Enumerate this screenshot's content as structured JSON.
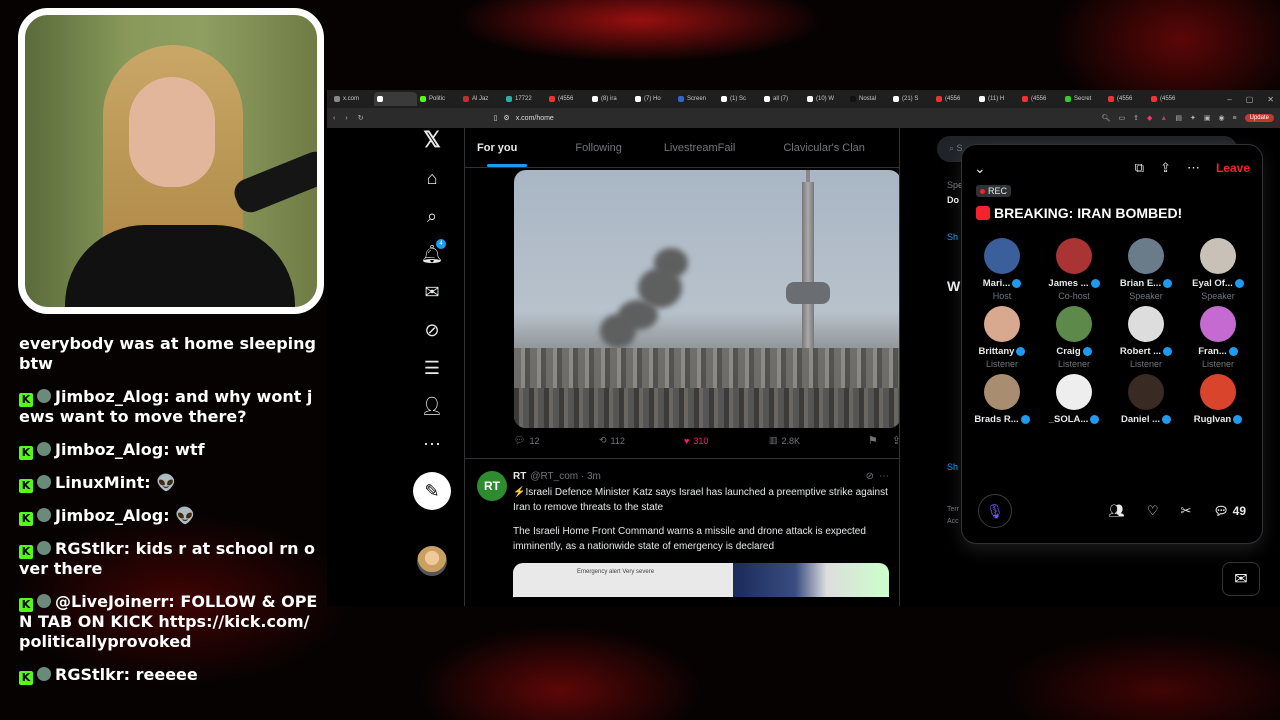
{
  "chat": {
    "messages": [
      {
        "user": "",
        "text": "everybody was at home sleeping btw"
      },
      {
        "user": "Jimboz_Alog",
        "text": ": and why wont jews want to move there?"
      },
      {
        "user": "Jimboz_Alog",
        "text": ": wtf"
      },
      {
        "user": "LinuxMint",
        "text": ": 👽"
      },
      {
        "user": "Jimboz_Alog",
        "text": ": 👽"
      },
      {
        "user": "RGStlkr",
        "text": ": kids r at school rn over there"
      },
      {
        "user": "@LiveJoinerr",
        "text": ": FOLLOW & OPEN TAB ON KICK https://kick.com/politicallyprovoked"
      },
      {
        "user": "RGStlkr",
        "text": ": reeeee"
      }
    ]
  },
  "browser": {
    "tabs": [
      {
        "label": "x.com",
        "color": "#888"
      },
      {
        "label": "",
        "color": "#fff",
        "active": true
      },
      {
        "label": "Politic",
        "color": "#53fc18"
      },
      {
        "label": "Al Jaz",
        "color": "#c03030"
      },
      {
        "label": "17722",
        "color": "#3aa"
      },
      {
        "label": "(4556",
        "color": "#e33"
      },
      {
        "label": "(8) ira",
        "color": "#fff"
      },
      {
        "label": "(7) Ho",
        "color": "#fff"
      },
      {
        "label": "Screen",
        "color": "#36c"
      },
      {
        "label": "(1) Sc",
        "color": "#fff"
      },
      {
        "label": "all (7)",
        "color": "#fff"
      },
      {
        "label": "(10) W",
        "color": "#fff"
      },
      {
        "label": "Nostal",
        "color": "#111"
      },
      {
        "label": "(21) S",
        "color": "#fff"
      },
      {
        "label": "(4556",
        "color": "#e33"
      },
      {
        "label": "(11) H",
        "color": "#fff"
      },
      {
        "label": "(4556",
        "color": "#e33"
      },
      {
        "label": "Secret",
        "color": "#3c3"
      },
      {
        "label": "(4556",
        "color": "#e33"
      },
      {
        "label": "(4556",
        "color": "#e33"
      }
    ],
    "url": "x.com/home",
    "update_label": "Update"
  },
  "feed": {
    "tabs": [
      "For you",
      "Following",
      "LivestreamFail",
      "Clavicular's Clan"
    ],
    "post1": {
      "replies": "12",
      "reposts": "112",
      "likes": "310",
      "views": "2.8K"
    },
    "post2": {
      "avatar": "RT",
      "name": "RT",
      "handle": "@RT_com · 3m",
      "para1": "⚡Israeli Defence Minister Katz says Israel has launched a preemptive strike against Iran to remove threats to the state",
      "para2": "The Israeli Home Front Command warns a missile and drone attack is expected imminently, as a nationwide state of emergency is declared",
      "media_text": "Emergency alert  Very severe"
    }
  },
  "right": {
    "search": "S",
    "ghost1": "Spe",
    "ghost2": "Do",
    "ghost3": "Sh",
    "ghost4": "W",
    "ghost5": "Sh",
    "ghost6": "Terr",
    "ghost7": "Acc"
  },
  "spaces": {
    "rec": "REC",
    "title": "BREAKING: IRAN BOMBED!",
    "leave": "Leave",
    "comment_count": "49",
    "participants": [
      {
        "name": "Mari...",
        "role": "Host",
        "color": "#3a5f9a"
      },
      {
        "name": "James ...",
        "role": "Co-host",
        "color": "#a33"
      },
      {
        "name": "Brian E...",
        "role": "Speaker",
        "color": "#6a7b8a"
      },
      {
        "name": "Eyal Of...",
        "role": "Speaker",
        "color": "#c9c0b8"
      },
      {
        "name": "Brittany",
        "role": "Listener",
        "color": "#d8a98f"
      },
      {
        "name": "Craig",
        "role": "Listener",
        "color": "#5d8a4a"
      },
      {
        "name": "Robert ...",
        "role": "Listener",
        "color": "#ddd"
      },
      {
        "name": "Fran...",
        "role": "Listener",
        "color": "#c46ad0"
      },
      {
        "name": "Brads R...",
        "role": "",
        "color": "#a98d70"
      },
      {
        "name": "_SOLA...",
        "role": "",
        "color": "#eee"
      },
      {
        "name": "Daniel ...",
        "role": "",
        "color": "#3a2a24"
      },
      {
        "name": "RugIvan",
        "role": "",
        "color": "#d8452c"
      }
    ]
  },
  "colors": {
    "accent": "#1d9bf0",
    "like": "#f91880",
    "leave": "#f4212e",
    "kick": "#53fc18"
  }
}
